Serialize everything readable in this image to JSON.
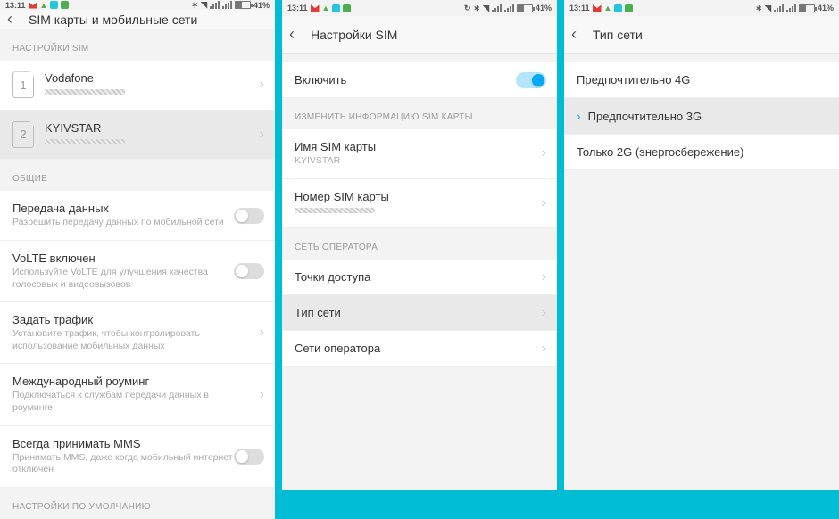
{
  "status": {
    "time": "13:11",
    "battery_pct": "41%"
  },
  "screen1": {
    "header": "SIM карты и мобильные сети",
    "sections": {
      "sim_settings": "НАСТРОЙКИ SIM",
      "general": "ОБЩИЕ",
      "defaults": "НАСТРОЙКИ ПО УМОЛЧАНИЮ"
    },
    "sim1": {
      "name": "Vodafone",
      "slot": "1"
    },
    "sim2": {
      "name": "KYIVSTAR",
      "slot": "2"
    },
    "data": {
      "title": "Передача данных",
      "sub": "Разрешить передачу данных по мобильной сети"
    },
    "volte": {
      "title": "VoLTE включен",
      "sub": "Используйте VoLTE для улучшения качества голосовых и видеовызовов"
    },
    "traffic": {
      "title": "Задать трафик",
      "sub": "Установите трафик, чтобы контролировать использование мобильных данных"
    },
    "roaming": {
      "title": "Международный роуминг",
      "sub": "Подключаться к службам передачи данных в роуминге"
    },
    "mms": {
      "title": "Всегда принимать MMS",
      "sub": "Принимать MMS, даже когда мобильный интернет отключен"
    }
  },
  "screen2": {
    "header": "Настройки SIM",
    "enable": "Включить",
    "sections": {
      "edit": "ИЗМЕНИТЬ ИНФОРМАЦИЮ SIM КАРТЫ",
      "operator": "СЕТЬ ОПЕРАТОРА"
    },
    "sim_name": {
      "title": "Имя SIM карты",
      "value": "KYIVSTAR"
    },
    "sim_number": {
      "title": "Номер SIM карты"
    },
    "apn": "Точки доступа",
    "net_type": "Тип сети",
    "operator": "Сети оператора"
  },
  "screen3": {
    "header": "Тип сети",
    "opt_4g": "Предпочтительно 4G",
    "opt_3g": "Предпочтительно 3G",
    "opt_2g": "Только 2G (энергосбережение)"
  }
}
